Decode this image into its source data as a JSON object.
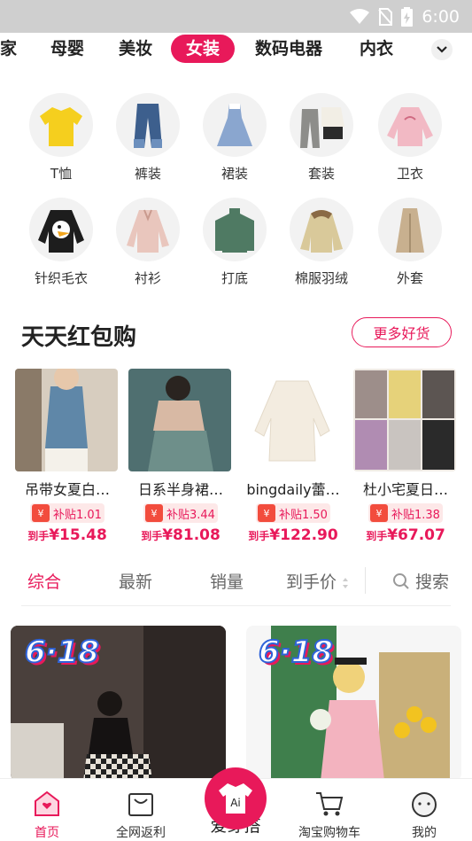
{
  "status_bar": {
    "time": "6:00"
  },
  "categories": [
    "家",
    "母婴",
    "美妆",
    "女装",
    "数码电器",
    "内衣"
  ],
  "active_category": "女装",
  "subcategories": [
    "T恤",
    "裤装",
    "裙装",
    "套装",
    "卫衣",
    "针织毛衣",
    "衬衫",
    "打底",
    "棉服羽绒",
    "外套"
  ],
  "section": {
    "title": "天天红包购",
    "more_label": "更多好货"
  },
  "products": [
    {
      "name": "吊带女夏白…",
      "subsidy": "补贴1.01",
      "price_prefix": "到手",
      "price": "¥15.48"
    },
    {
      "name": "日系半身裙…",
      "subsidy": "补贴3.44",
      "price_prefix": "到手",
      "price": "¥81.08"
    },
    {
      "name": "bingdaily蕾…",
      "subsidy": "补贴1.50",
      "price_prefix": "到手",
      "price": "¥122.90"
    },
    {
      "name": "杜小宅夏日…",
      "subsidy": "补贴1.38",
      "price_prefix": "到手",
      "price": "¥67.07"
    }
  ],
  "sort": {
    "items": [
      "综合",
      "最新",
      "销量",
      "到手价"
    ],
    "search_label": "搜索",
    "active": "综合"
  },
  "feed": [
    {
      "badge": "6·18"
    },
    {
      "badge": "6·18"
    }
  ],
  "tabbar": {
    "items": [
      "首页",
      "全网返利",
      "爱穿搭",
      "淘宝购物车",
      "我的"
    ],
    "center_icon_text": "Ai",
    "active": "首页"
  },
  "colors": {
    "accent": "#e8195a",
    "status_bar": "#cfcfcf"
  }
}
